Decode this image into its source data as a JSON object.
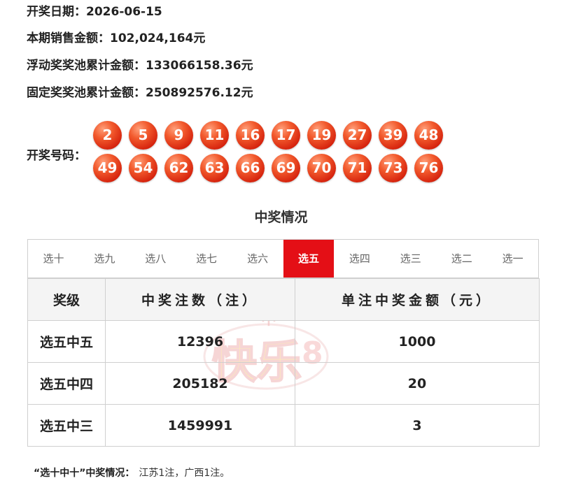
{
  "info": [
    {
      "label": "开奖日期：",
      "value": "2026-06-15"
    },
    {
      "label": "本期销售金额：",
      "value": "102,024,164元"
    },
    {
      "label": "浮动奖奖池累计金额：",
      "value": "133066158.36元"
    },
    {
      "label": "固定奖奖池累计金额：",
      "value": "250892576.12元"
    }
  ],
  "numbers_label": "开奖号码：",
  "numbers": [
    "2",
    "5",
    "9",
    "11",
    "16",
    "17",
    "19",
    "27",
    "39",
    "48",
    "49",
    "54",
    "62",
    "63",
    "66",
    "69",
    "70",
    "71",
    "73",
    "76"
  ],
  "section_title": "中奖情况",
  "tabs": [
    "选十",
    "选九",
    "选八",
    "选七",
    "选六",
    "选五",
    "选四",
    "选三",
    "选二",
    "选一"
  ],
  "active_tab": "选五",
  "table": {
    "headers": [
      "奖级",
      "中奖注数（注）",
      "单注中奖金额（元）"
    ],
    "rows": [
      [
        "选五中五",
        "12396",
        "1000"
      ],
      [
        "选五中四",
        "205182",
        "20"
      ],
      [
        "选五中三",
        "1459991",
        "3"
      ]
    ]
  },
  "watermark": {
    "top": "中",
    "main": "快乐",
    "digit": "8"
  },
  "note": {
    "label": "“选十中十”中奖情况：",
    "value": "江苏1注，广西1注。"
  },
  "colors": {
    "accent": "#e40f16",
    "ball": "#e3300f"
  }
}
